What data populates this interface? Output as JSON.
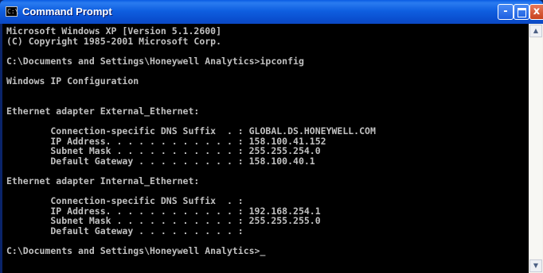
{
  "window": {
    "title": "Command Prompt",
    "icon_label": "C:\\",
    "buttons": {
      "minimize": "-",
      "close": "x"
    }
  },
  "console": {
    "lines": [
      "Microsoft Windows XP [Version 5.1.2600]",
      "(C) Copyright 1985-2001 Microsoft Corp.",
      "",
      "C:\\Documents and Settings\\Honeywell Analytics>ipconfig",
      "",
      "Windows IP Configuration",
      "",
      "",
      "Ethernet adapter External_Ethernet:",
      "",
      "        Connection-specific DNS Suffix  . : GLOBAL.DS.HONEYWELL.COM",
      "        IP Address. . . . . . . . . . . . : 158.100.41.152",
      "        Subnet Mask . . . . . . . . . . . : 255.255.254.0",
      "        Default Gateway . . . . . . . . . : 158.100.40.1",
      "",
      "Ethernet adapter Internal_Ethernet:",
      "",
      "        Connection-specific DNS Suffix  . :",
      "        IP Address. . . . . . . . . . . . : 192.168.254.1",
      "        Subnet Mask . . . . . . . . . . . : 255.255.255.0",
      "        Default Gateway . . . . . . . . . :",
      "",
      "C:\\Documents and Settings\\Honeywell Analytics>"
    ],
    "cursor": "_"
  },
  "scrollbar": {
    "up_arrow": "▲",
    "down_arrow": "▼"
  },
  "colors": {
    "titlebar": "#0a5ce3",
    "console_bg": "#000000",
    "console_text": "#c0c0c0",
    "close_button": "#c8421e"
  }
}
